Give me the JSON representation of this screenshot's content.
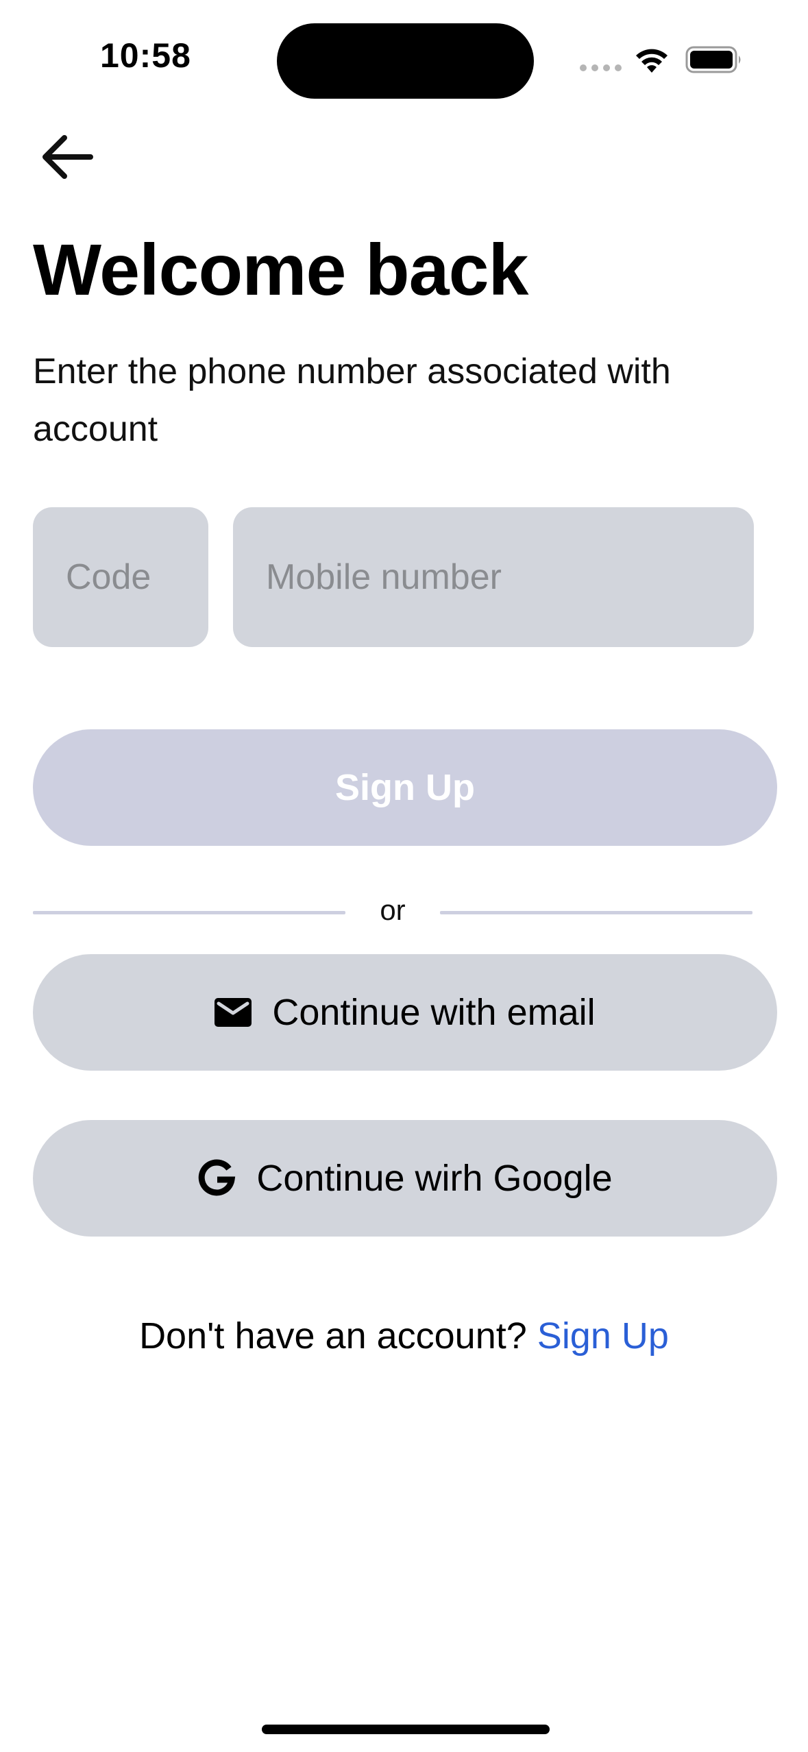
{
  "status_bar": {
    "time": "10:58"
  },
  "header": {
    "back_icon": "arrow-left-icon"
  },
  "main": {
    "title": "Welcome back",
    "subtitle": "Enter the phone number associated with account",
    "code_input": {
      "placeholder": "Code",
      "value": ""
    },
    "mobile_input": {
      "placeholder": "Mobile number",
      "value": ""
    },
    "signup_button_label": "Sign Up",
    "divider_text": "or",
    "email_button": {
      "label": "Continue with email",
      "icon": "envelope-icon"
    },
    "google_button": {
      "label": "Continue wirh Google",
      "icon": "google-icon"
    },
    "footer": {
      "prompt": "Don't have an account?",
      "link_label": "Sign Up"
    }
  },
  "colors": {
    "input_background": "#d2d5dc",
    "disabled_button": "#cdcfe0",
    "link": "#2a5fd6"
  }
}
